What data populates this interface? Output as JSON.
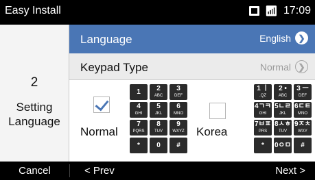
{
  "status_bar": {
    "title": "Easy Install",
    "time": "17:09",
    "icons": [
      "sim-icon",
      "wifi-icon"
    ]
  },
  "left_panel": {
    "step_number": "2",
    "step_label_line1": "Setting",
    "step_label_line2": "Language"
  },
  "language_row": {
    "label": "Language",
    "value": "English"
  },
  "keypad_row": {
    "label": "Keypad Type",
    "value": "Normal"
  },
  "options": {
    "normal": {
      "label": "Normal",
      "checked": true,
      "keys": [
        {
          "d": "1",
          "l": ""
        },
        {
          "d": "2",
          "l": "ABC"
        },
        {
          "d": "3",
          "l": "DEF"
        },
        {
          "d": "4",
          "l": "GHI"
        },
        {
          "d": "5",
          "l": "JKL"
        },
        {
          "d": "6",
          "l": "MNO"
        },
        {
          "d": "7",
          "l": "PQRS"
        },
        {
          "d": "8",
          "l": "TUV"
        },
        {
          "d": "9",
          "l": "WXYZ"
        },
        {
          "d": "*",
          "l": ""
        },
        {
          "d": "0",
          "l": ""
        },
        {
          "d": "#",
          "l": ""
        }
      ]
    },
    "korea": {
      "label": "Korea",
      "checked": false,
      "keys": [
        {
          "d": "1 ㅣ",
          "l": ".QZ"
        },
        {
          "d": "2 •",
          "l": "ABC"
        },
        {
          "d": "3 ㅡ",
          "l": "DEF"
        },
        {
          "d": "4ㄱㅋ",
          "l": "GHI"
        },
        {
          "d": "5ㄴㄹ",
          "l": "JKL"
        },
        {
          "d": "6ㄷㅌ",
          "l": "MNO"
        },
        {
          "d": "7ㅂㅍ",
          "l": "PRS"
        },
        {
          "d": "8ㅅㅎ",
          "l": "TUV"
        },
        {
          "d": "9ㅈㅊ",
          "l": "WXY"
        },
        {
          "d": "*",
          "l": ""
        },
        {
          "d": "0ㅇㅁ",
          "l": ""
        },
        {
          "d": "#",
          "l": ""
        }
      ]
    }
  },
  "bottom_bar": {
    "cancel": "Cancel",
    "prev": "< Prev",
    "next": "Next >"
  },
  "colors": {
    "accent": "#4a76b5",
    "key": "#2b2b2b"
  }
}
